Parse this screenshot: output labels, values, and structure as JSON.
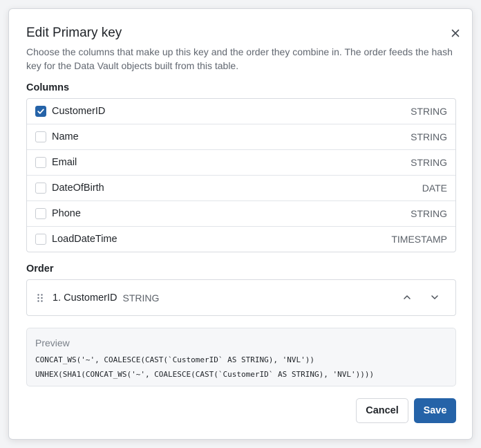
{
  "dialog": {
    "title": "Edit Primary key",
    "description": "Choose the columns that make up this key and the order they combine in. The order feeds the hash key for the Data Vault objects built from this table.",
    "close_icon": "close-icon"
  },
  "columns": {
    "label": "Columns",
    "items": [
      {
        "name": "CustomerID",
        "type": "STRING",
        "checked": true
      },
      {
        "name": "Name",
        "type": "STRING",
        "checked": false
      },
      {
        "name": "Email",
        "type": "STRING",
        "checked": false
      },
      {
        "name": "DateOfBirth",
        "type": "DATE",
        "checked": false
      },
      {
        "name": "Phone",
        "type": "STRING",
        "checked": false
      },
      {
        "name": "LoadDateTime",
        "type": "TIMESTAMP",
        "checked": false
      }
    ]
  },
  "order": {
    "label": "Order",
    "items": [
      {
        "name": "1. CustomerID",
        "type": "STRING"
      }
    ],
    "icons": {
      "drag": "drag-handle-icon",
      "up": "chevron-up-icon",
      "down": "chevron-down-icon"
    }
  },
  "preview": {
    "label": "Preview",
    "lines": [
      "CONCAT_WS('~', COALESCE(CAST(`CustomerID` AS STRING), 'NVL'))",
      "UNHEX(SHA1(CONCAT_WS('~', COALESCE(CAST(`CustomerID` AS STRING), 'NVL'))))"
    ]
  },
  "actions": {
    "cancel_label": "Cancel",
    "save_label": "Save"
  },
  "colors": {
    "accent": "#2563a8",
    "muted_text": "#616770",
    "border": "#d8dbe0"
  }
}
